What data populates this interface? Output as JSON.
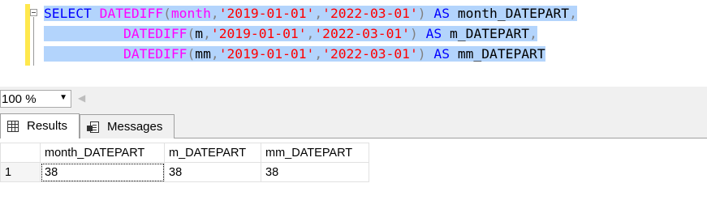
{
  "editor": {
    "line1": {
      "kw_select": "SELECT",
      "fn": "DATEDIFF",
      "open": "(",
      "part": "month",
      "comma1": ",",
      "date1": "'2019-01-01'",
      "comma2": ",",
      "date2": "'2022-03-01'",
      "close": ")",
      "kw_as": "AS",
      "alias": "month_DATEPART",
      "trail": ","
    },
    "line2": {
      "fn": "DATEDIFF",
      "open": "(",
      "part": "m",
      "comma1": ",",
      "date1": "'2019-01-01'",
      "comma2": ",",
      "date2": "'2022-03-01'",
      "close": ")",
      "kw_as": "AS",
      "alias": "m_DATEPART",
      "trail": ","
    },
    "line3": {
      "fn": "DATEDIFF",
      "open": "(",
      "part": "mm",
      "comma1": ",",
      "date1": "'2019-01-01'",
      "comma2": ",",
      "date2": "'2022-03-01'",
      "close": ")",
      "kw_as": "AS",
      "alias": "mm_DATEPART"
    }
  },
  "zoom": {
    "value": "100 %"
  },
  "tabs": {
    "results": "Results",
    "messages": "Messages"
  },
  "grid": {
    "columns": [
      "month_DATEPART",
      "m_DATEPART",
      "mm_DATEPART"
    ],
    "rows": [
      {
        "num": "1",
        "cells": [
          "38",
          "38",
          "38"
        ]
      }
    ]
  },
  "colors": {
    "keyword": "#0000ff",
    "function": "#ff00ff",
    "string": "#ff0000",
    "operator": "#808080",
    "selection": "#b3d4fc",
    "change_marker": "#ffe84d"
  },
  "icons": {
    "results_tab": "grid-icon",
    "messages_tab": "messages-icon",
    "zoom_dropdown": "chevron-down-icon",
    "scroll_left": "scroll-left-icon",
    "collapse": "collapse-icon"
  }
}
